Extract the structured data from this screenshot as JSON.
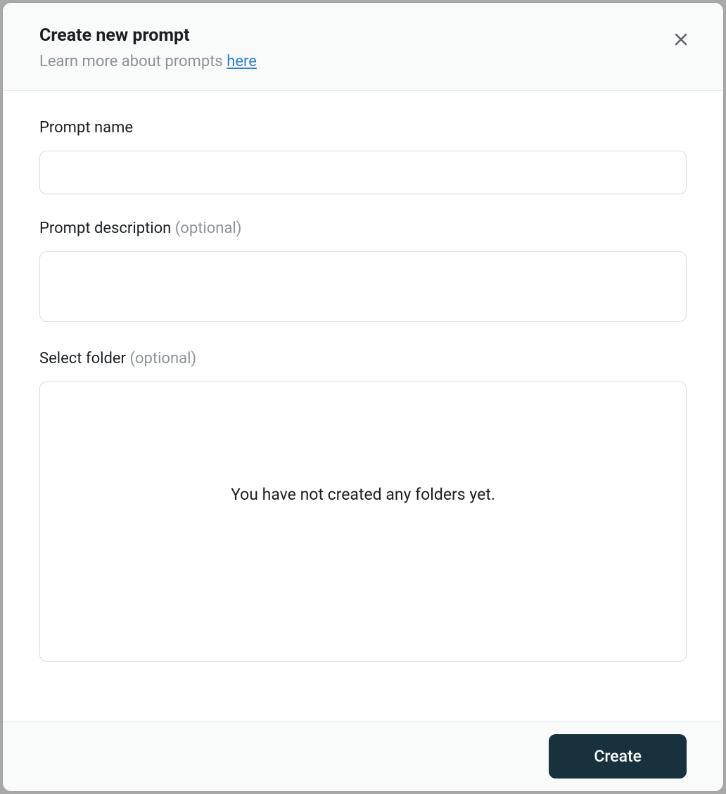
{
  "header": {
    "title": "Create new prompt",
    "subtitle_prefix": "Learn more about prompts ",
    "subtitle_link": "here"
  },
  "form": {
    "prompt_name": {
      "label": "Prompt name",
      "value": ""
    },
    "prompt_description": {
      "label_text": "Prompt description ",
      "label_optional": "(optional)",
      "value": ""
    },
    "select_folder": {
      "label_text": "Select folder ",
      "label_optional": "(optional)",
      "empty_message": "You have not created any folders yet."
    }
  },
  "footer": {
    "create_button": "Create"
  }
}
